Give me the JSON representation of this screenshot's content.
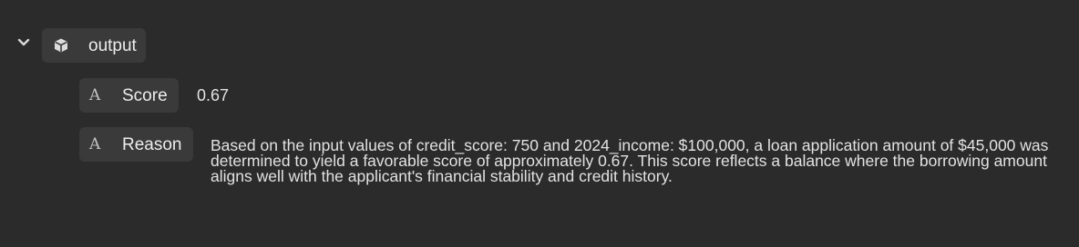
{
  "tree": {
    "node": {
      "label": "output",
      "icon": "cube-icon",
      "toggle_icon": "chevron-down-icon",
      "expanded": true
    },
    "fields": [
      {
        "type_icon": "A",
        "label": "Score",
        "value": "0.67"
      },
      {
        "type_icon": "A",
        "label": "Reason",
        "value": "Based on the input values of credit_score: 750 and 2024_income: $100,000, a loan application amount of $45,000 was determined to yield a favorable score of approximately 0.67. This score reflects a balance where the borrowing amount aligns well with the applicant's financial stability and credit history."
      }
    ]
  },
  "colors": {
    "background": "#2b2b2b",
    "chip": "#3a3a3a",
    "text": "#e4e4e4"
  }
}
